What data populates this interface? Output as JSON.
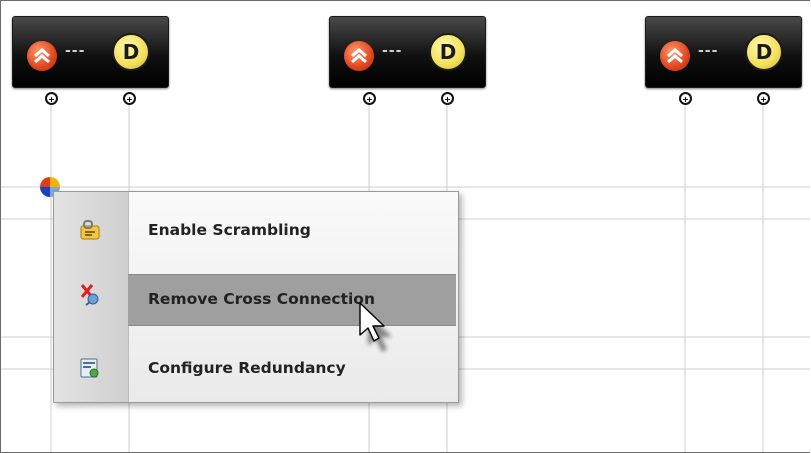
{
  "nodes": [
    {
      "dash": "---",
      "badge": "D"
    },
    {
      "dash": "---",
      "badge": "D"
    },
    {
      "dash": "---",
      "badge": "D"
    }
  ],
  "context_menu": {
    "items": [
      {
        "label": "Enable Scrambling",
        "icon": "scrambling-icon"
      },
      {
        "label": "Remove Cross Connection",
        "icon": "remove-connection-icon",
        "highlighted": true
      },
      {
        "label": "Configure Redundancy",
        "icon": "redundancy-icon"
      }
    ]
  },
  "colors": {
    "node_bg": "#111111",
    "orange_badge": "#e0451d",
    "d_badge": "#f2df5a",
    "menu_highlight": "#9f9f9f"
  }
}
